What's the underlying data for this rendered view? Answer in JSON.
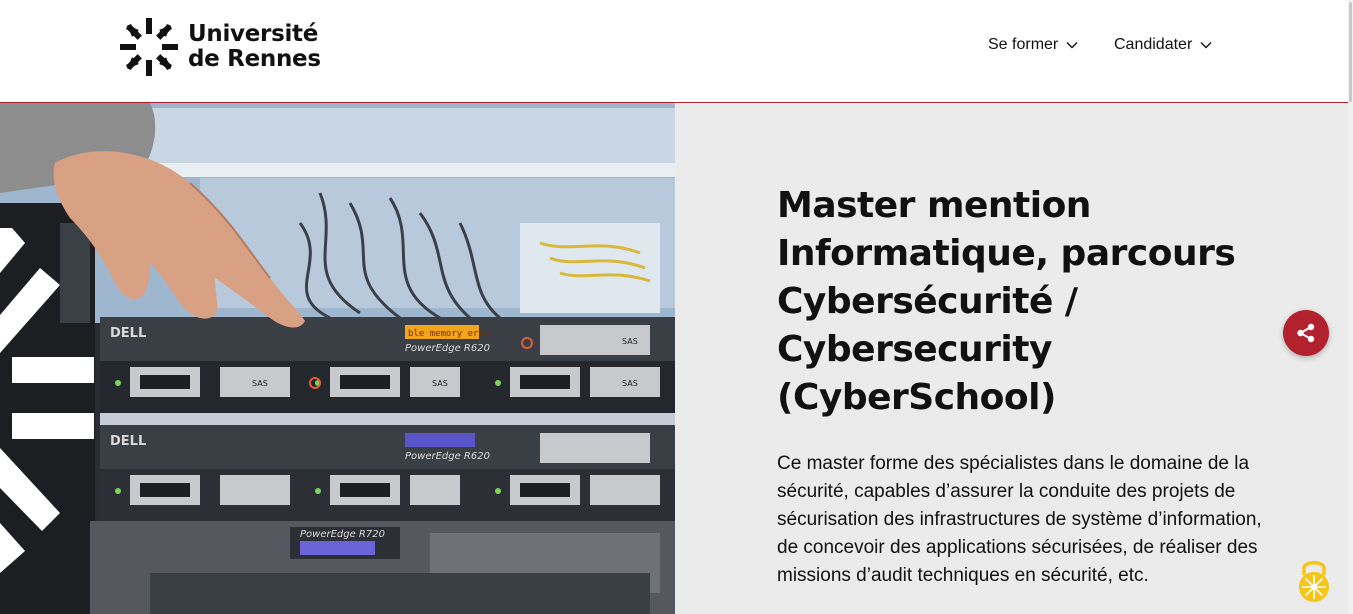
{
  "header": {
    "logo": {
      "line1": "Université",
      "line2": "de Rennes",
      "icon": "university-star-logo"
    },
    "nav": [
      {
        "label": "Se former",
        "icon": "chevron-down-icon"
      },
      {
        "label": "Candidater",
        "icon": "chevron-down-icon"
      }
    ]
  },
  "hero": {
    "image": "server-rack-photo",
    "rack_labels": {
      "brand": "DELL",
      "model_1": "PowerEdge R620",
      "model_2": "PowerEdge R620",
      "model_3": "PowerEdge R720",
      "lcd_message": "ble memory erro",
      "drive_label": "SAS"
    },
    "title": "Master mention Informatique, parcours Cybersécurité / Cybersecurity (CyberSchool)",
    "description": "Ce master forme des spécialistes dans le domaine de la sécurité, capables d’assurer la conduite des projets de sécurisation des infrastructures de système d’information, de concevoir des applications sécurisées, de réaliser des missions d’audit techniques en sécurité, etc."
  },
  "floating": {
    "share_icon": "share-icon",
    "lock_icon": "lock-icon"
  },
  "colors": {
    "accent": "#b2222e",
    "panel_bg": "#ebebeb",
    "lock": "#f5c518"
  }
}
